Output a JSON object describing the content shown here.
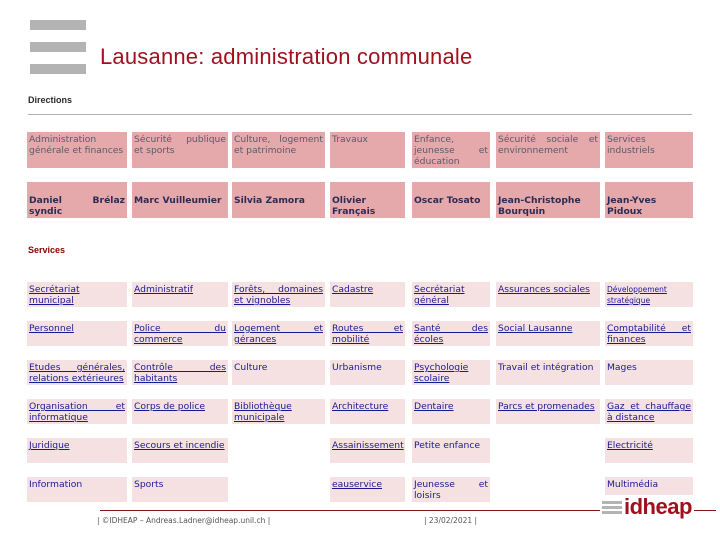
{
  "header": {
    "title": "Lausanne: administration communale"
  },
  "sections": {
    "directions_label": "Directions",
    "services_label": "Services"
  },
  "directions": [
    {
      "name": "Administration générale et finances",
      "head": "Daniel Brélaz syndic"
    },
    {
      "name": "Sécurité publique et sports",
      "head": "Marc Vuilleumier"
    },
    {
      "name": "Culture, logement et patrimoine",
      "head": "Silvia Zamora"
    },
    {
      "name": "Travaux",
      "head": "Olivier Français"
    },
    {
      "name": "Enfance, jeunesse et éducation",
      "head": "Oscar Tosato"
    },
    {
      "name": "Sécurité sociale et environnement",
      "head": "Jean-Christophe Bourquin"
    },
    {
      "name": "Services industriels",
      "head": "Jean-Yves Pidoux"
    }
  ],
  "services": [
    [
      "Secrétariat municipal",
      "Personnel",
      "Etudes générales, relations extérieures",
      "Organisation et informatique",
      "Juridique",
      "Information"
    ],
    [
      "Administratif",
      "Police du commerce",
      "Contrôle des habitants",
      "Corps de police",
      "Secours et incendie",
      "Sports"
    ],
    [
      "Forêts, domaines et vignobles",
      "Logement et gérances",
      "Culture",
      "Bibliothèque municipale",
      "",
      ""
    ],
    [
      "Cadastre",
      "Routes et mobilité",
      "Urbanisme",
      "Architecture",
      "Assainissement",
      "eauservice"
    ],
    [
      "Secrétariat général",
      "Santé des écoles",
      "Psychologie scolaire",
      "Dentaire",
      "Petite enfance",
      "Jeunesse et loisirs"
    ],
    [
      "Assurances sociales",
      "Social Lausanne",
      "Travail et intégration",
      "Parcs et promenades",
      "",
      ""
    ],
    [
      "Développement stratégique",
      "Comptabilité et finances",
      "Mages",
      "Gaz et chauffage à distance",
      "Electricité",
      "Multimédia"
    ]
  ],
  "footer": {
    "left": "| ©IDHEAP – Andreas.Ladner@idheap.unil.ch |",
    "date": "| 23/02/2021 |",
    "logo_text": "idheap"
  },
  "colors": {
    "title": "#a0101e",
    "direction_cell": "#e5a9ab",
    "service_cell": "#f5e1e2",
    "link_text": "#1a1a90"
  }
}
